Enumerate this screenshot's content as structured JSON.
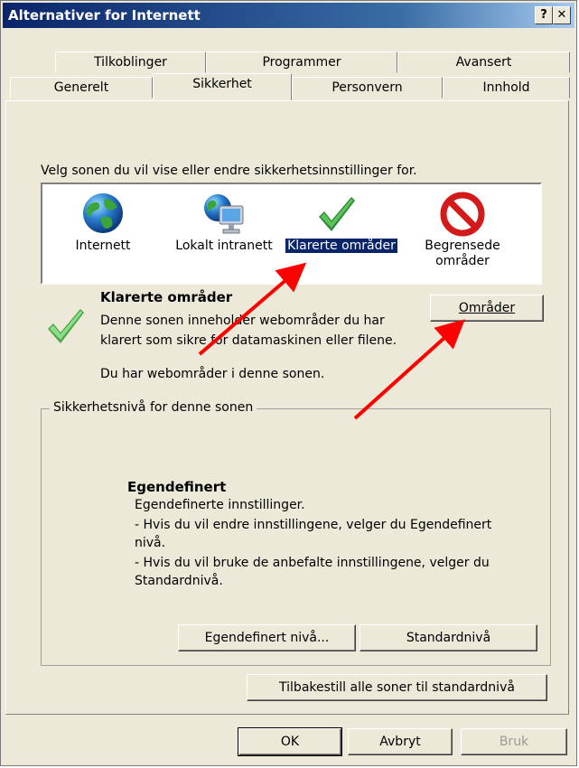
{
  "window": {
    "title": "Alternativer for Internett",
    "help_button": "?",
    "close_button": "✕"
  },
  "tabs": {
    "row1": [
      "Tilkoblinger",
      "Programmer",
      "Avansert"
    ],
    "row2": [
      "Generelt",
      "Sikkerhet",
      "Personvern",
      "Innhold"
    ],
    "active": "Sikkerhet"
  },
  "zones": {
    "prompt": "Velg sonen du vil vise eller endre sikkerhetsinnstillinger for.",
    "items": [
      {
        "label": "Internett",
        "icon": "globe-icon"
      },
      {
        "label": "Lokalt intranett",
        "icon": "intranet-computer-icon"
      },
      {
        "label": "Klarerte områder",
        "icon": "green-checkmark-icon",
        "selected": true
      },
      {
        "label_line1": "Begrensede",
        "label_line2": "områder",
        "icon": "restricted-sign-icon"
      }
    ]
  },
  "selected_zone": {
    "title": "Klarerte områder",
    "desc_line1": "Denne sonen inneholder webområder du har",
    "desc_line2": "klarert som sikre for datamaskinen eller filene.",
    "status": "Du har webområder i denne sonen.",
    "sites_button": "Områder"
  },
  "security_level": {
    "group_label": "Sikkerhetsnivå for denne sonen",
    "level_title": "Egendefinert",
    "line1": "Egendefinerte innstillinger.",
    "line2": "- Hvis du vil endre innstillingene, velger du Egendefinert",
    "line3": "nivå.",
    "line4": "- Hvis du vil bruke de anbefalte innstillingene, velger du",
    "line5": "Standardnivå.",
    "custom_button": "Egendefinert nivå...",
    "default_button": "Standardnivå"
  },
  "reset_button": "Tilbakestill alle soner til standardnivå",
  "footer": {
    "ok": "OK",
    "cancel": "Avbryt",
    "apply": "Bruk"
  },
  "colors": {
    "dialog_bg": "#ece9d8",
    "title_bar": "#0a246a",
    "selection": "#0a246a",
    "annotation_arrow": "#ff0000"
  }
}
